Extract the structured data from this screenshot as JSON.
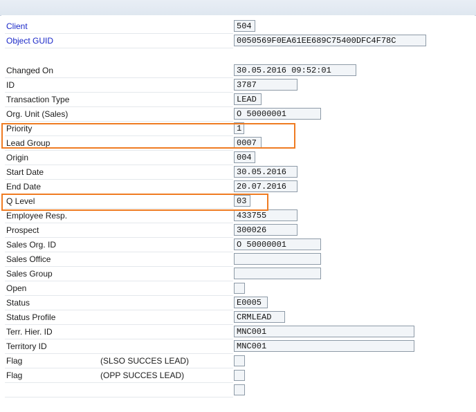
{
  "fields": {
    "client": {
      "label": "Client",
      "value": "504"
    },
    "object_guid": {
      "label": "Object GUID",
      "value": "0050569F0EA61EE689C75400DFC4F78C"
    },
    "changed_on": {
      "label": "Changed On",
      "value": "30.05.2016 09:52:01"
    },
    "id": {
      "label": "ID",
      "value": "3787"
    },
    "transaction_type": {
      "label": "Transaction Type",
      "value": "LEAD"
    },
    "org_unit": {
      "label": "Org. Unit (Sales)",
      "value": "O 50000001"
    },
    "priority": {
      "label": "Priority",
      "value": "1"
    },
    "lead_group": {
      "label": "Lead Group",
      "value": "0007"
    },
    "origin": {
      "label": "Origin",
      "value": "004"
    },
    "start_date": {
      "label": "Start Date",
      "value": "30.05.2016"
    },
    "end_date": {
      "label": "End Date",
      "value": "20.07.2016"
    },
    "q_level": {
      "label": "Q Level",
      "value": "03"
    },
    "employee_resp": {
      "label": "Employee Resp.",
      "value": "433755"
    },
    "prospect": {
      "label": "Prospect",
      "value": "300026"
    },
    "sales_org_id": {
      "label": "Sales Org. ID",
      "value": "O 50000001"
    },
    "sales_office": {
      "label": "Sales Office",
      "value": ""
    },
    "sales_group": {
      "label": "Sales Group",
      "value": ""
    },
    "open": {
      "label": "Open"
    },
    "status": {
      "label": "Status",
      "value": "E0005"
    },
    "status_profile": {
      "label": "Status Profile",
      "value": "CRMLEAD"
    },
    "terr_hier_id": {
      "label": "Terr. Hier. ID",
      "value": "MNC001"
    },
    "territory_id": {
      "label": "Territory ID",
      "value": "MNC001"
    },
    "flag_1": {
      "label": "Flag",
      "sublabel": "(SLSO SUCCES LEAD)"
    },
    "flag_2": {
      "label": "Flag",
      "sublabel": "(OPP SUCCES LEAD)"
    }
  },
  "highlight_color": "#ef7b21",
  "link_color": "#1a28c8"
}
